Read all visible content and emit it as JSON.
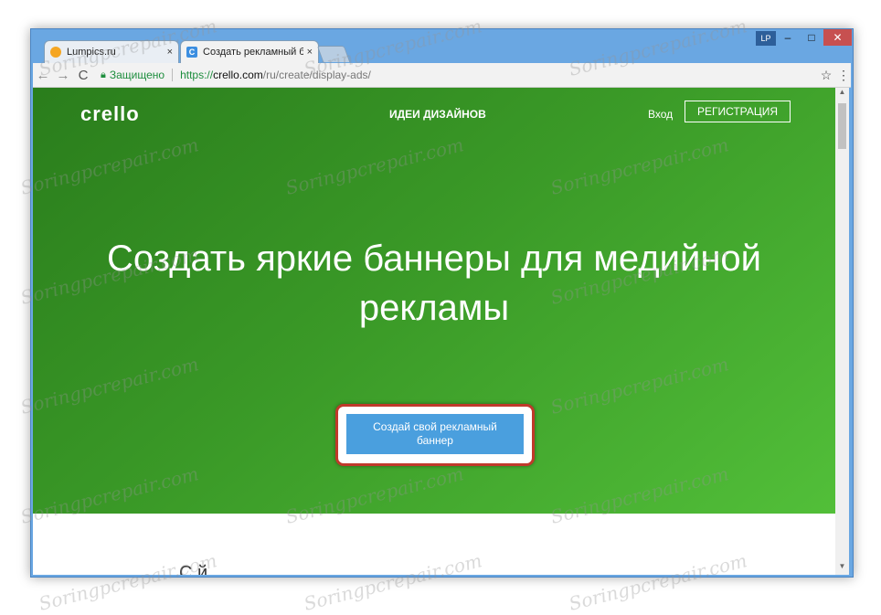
{
  "browser": {
    "tabs": [
      {
        "title": "Lumpics.ru",
        "favicon": "lumpics-orange-icon",
        "close": "×"
      },
      {
        "title": "Создать рекламный баннер",
        "favicon": "crello-c-icon",
        "favicon_letter": "C",
        "close": "×"
      }
    ],
    "user_badge": "LP",
    "window_controls": {
      "minimize": "–",
      "maximize": "□",
      "close": "✕"
    },
    "toolbar": {
      "back": "←",
      "forward": "→",
      "reload": "C",
      "secure_label": "Защищено",
      "url_scheme": "https://",
      "url_host": "crello.com",
      "url_path": "/ru/create/display-ads/",
      "star": "☆",
      "menu": "⋮"
    }
  },
  "page": {
    "logo": "crello",
    "nav_ideas": "ИДЕИ ДИЗАЙНОВ",
    "login": "Вход",
    "register": "РЕГИСТРАЦИЯ",
    "headline": "Создать яркие баннеры для медийной рекламы",
    "cta_line1": "Создай свой рекламный",
    "cta_line2": "баннер",
    "below_partial": "С           й"
  },
  "watermark_text": "Soringpcrepair.com",
  "colors": {
    "hero_start": "#2a7d1c",
    "hero_end": "#52bf39",
    "cta_blue": "#4a9fde",
    "highlight_red": "#c0392b",
    "secure_green": "#1e8e3e"
  }
}
